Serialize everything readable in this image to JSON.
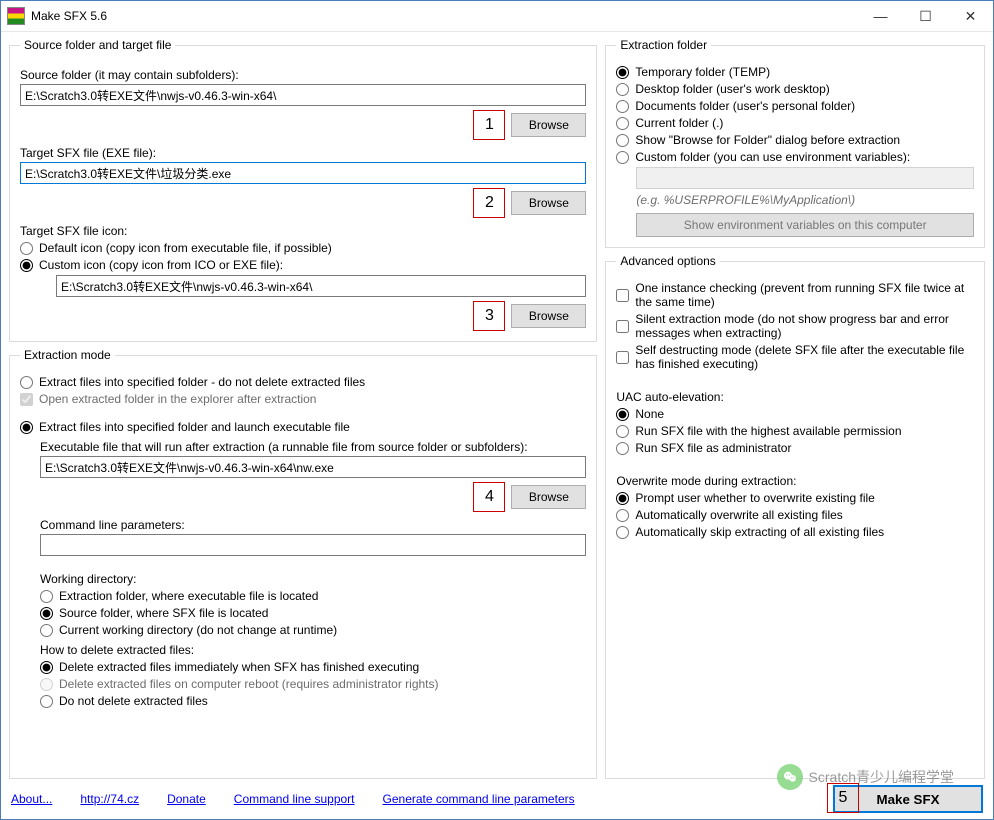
{
  "window": {
    "title": "Make SFX 5.6",
    "minimize_symbol": "—",
    "maximize_symbol": "☐",
    "close_symbol": "✕"
  },
  "source": {
    "legend": "Source folder and target file",
    "source_folder_label": "Source folder (it may contain subfolders):",
    "source_folder_value": "E:\\Scratch3.0转EXE文件\\nwjs-v0.46.3-win-x64\\",
    "browse1": "Browse",
    "anno1": "1",
    "target_sfx_label": "Target SFX file (EXE file):",
    "target_sfx_value": "E:\\Scratch3.0转EXE文件\\垃圾分类.exe",
    "browse2": "Browse",
    "anno2": "2",
    "icon_label": "Target SFX file icon:",
    "icon_default": "Default icon (copy icon from executable file, if possible)",
    "icon_custom": "Custom icon (copy icon from ICO or EXE file):",
    "icon_custom_value": "E:\\Scratch3.0转EXE文件\\nwjs-v0.46.3-win-x64\\",
    "browse3": "Browse",
    "anno3": "3"
  },
  "extraction_mode": {
    "legend": "Extraction mode",
    "opt_specified": "Extract files into specified folder - do not delete extracted files",
    "open_in_explorer": "Open extracted folder in the explorer after extraction",
    "opt_launch": "Extract files into specified folder and launch executable file",
    "exec_label": "Executable file that will run after extraction (a runnable file from source folder or subfolders):",
    "exec_value": "E:\\Scratch3.0转EXE文件\\nwjs-v0.46.3-win-x64\\nw.exe",
    "browse4": "Browse",
    "anno4": "4",
    "cmd_label": "Command line parameters:",
    "cmd_value": "",
    "wd_label": "Working directory:",
    "wd_extraction": "Extraction folder, where executable file is located",
    "wd_source": "Source folder, where SFX file is located",
    "wd_current": "Current working directory (do not change at runtime)",
    "del_label": "How to delete extracted files:",
    "del_immediate": "Delete extracted files immediately when SFX has finished executing",
    "del_reboot": "Delete extracted files on computer reboot (requires administrator rights)",
    "del_none": "Do not delete extracted files"
  },
  "extraction_folder": {
    "legend": "Extraction folder",
    "temp": "Temporary folder (TEMP)",
    "desktop": "Desktop folder (user's work desktop)",
    "documents": "Documents folder (user's personal folder)",
    "current": "Current folder (.)",
    "browse_dialog": "Show \"Browse for Folder\" dialog before extraction",
    "custom": "Custom folder (you can use environment variables):",
    "custom_value": "",
    "custom_hint": "(e.g. %USERPROFILE%\\MyApplication\\)",
    "env_btn": "Show environment variables on this computer"
  },
  "advanced": {
    "legend": "Advanced options",
    "one_instance": "One instance checking (prevent from running SFX file twice at the same time)",
    "silent": "Silent extraction mode (do not show progress bar and error messages when extracting)",
    "self_destruct": "Self destructing mode (delete SFX file after the executable file has finished executing)",
    "uac_label": "UAC auto-elevation:",
    "uac_none": "None",
    "uac_highest": "Run SFX file with the highest available permission",
    "uac_admin": "Run SFX file as administrator",
    "overwrite_label": "Overwrite mode during extraction:",
    "ov_prompt": "Prompt user whether to overwrite existing file",
    "ov_overwrite": "Automatically overwrite all existing files",
    "ov_skip": "Automatically skip extracting of all existing files"
  },
  "footer": {
    "about": "About...",
    "site": "http://74.cz",
    "donate": "Donate",
    "cl_support": "Command line support",
    "gen_params": "Generate command line parameters",
    "anno5": "5",
    "make": "Make SFX"
  },
  "overlay": {
    "wechat_text": "Scratch青少儿编程学堂"
  }
}
